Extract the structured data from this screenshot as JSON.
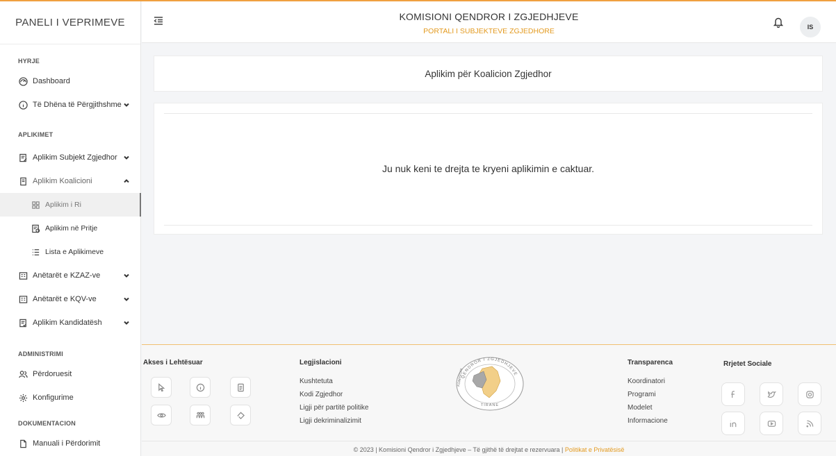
{
  "brand": "PANELI I VEPRIMEVE",
  "header": {
    "title": "KOMISIONI QENDROR I ZGJEDHJEVE",
    "subtitle": "PORTALI I SUBJEKTEVE ZGJEDHORE",
    "avatar": "IS"
  },
  "sidebar": {
    "sec_hyrje": "HYRJE",
    "dashboard": "Dashboard",
    "te_dhena": "Të Dhëna të Përgjithshme",
    "sec_aplikimet": "APLIKIMET",
    "aplikim_subjekt": "Aplikim Subjekt Zgjedhor",
    "aplikim_koalicioni": "Aplikim Koalicioni",
    "aplikim_ri": "Aplikim i Ri",
    "aplikim_pritje": "Aplikim në Pritje",
    "lista": "Lista e Aplikimeve",
    "kzaz": "Anëtarët e KZAZ-ve",
    "kqv": "Anëtarët e KQV-ve",
    "kandidatesh": "Aplikim Kandidatësh",
    "sec_admin": "ADMINISTRIMI",
    "perdoruesit": "Përdoruesit",
    "konfigurime": "Konfigurime",
    "sec_dok": "DOKUMENTACION",
    "manuali": "Manuali i Përdorimit"
  },
  "main": {
    "card_title": "Aplikim për Koalicion Zgjedhor",
    "message": "Ju nuk keni te drejta te kryeni aplikimin e caktuar."
  },
  "footer": {
    "akses_title": "Akses i Lehtësuar",
    "legj_title": "Legjislacioni",
    "legj": [
      "Kushtetuta",
      "Kodi Zgjedhor",
      "Ligji për partitë politike",
      "Ligji dekriminalizimit"
    ],
    "transp_title": "Transparenca",
    "transp": [
      "Koordinatori",
      "Programi",
      "Modelet",
      "Informacione"
    ],
    "social_title": "Rrjetet Sociale",
    "seal_top": "QENDROR I ZGJEDHJEVE",
    "seal_left": "KOMISIONI",
    "seal_bottom": "TIRANE",
    "copyright_pre": "© 2023  |  Komisioni Qendror i Zgjedhjeve – Të gjithë të drejtat e rezervuara  |  ",
    "copyright_link": "Politikat e Privatësisë"
  },
  "colors": {
    "accent": "#e39a1f",
    "top_border": "#f0a040"
  }
}
